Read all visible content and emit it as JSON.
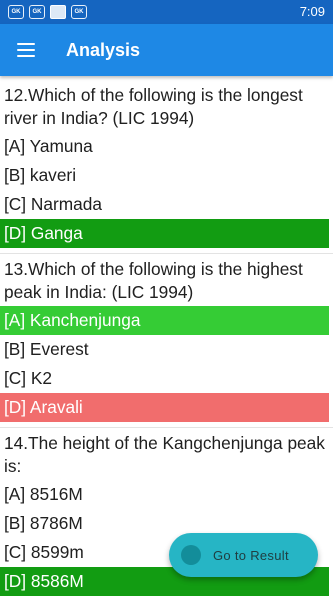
{
  "status_bar": {
    "time": "7:09",
    "notification_icons": [
      {
        "name": "gk-app-icon",
        "text": "GK"
      },
      {
        "name": "gk-app-icon",
        "text": "GK"
      },
      {
        "name": "image-icon",
        "text": ""
      },
      {
        "name": "gk-app-icon",
        "text": "GK"
      }
    ]
  },
  "app_bar": {
    "title": "Analysis",
    "menu_icon": "hamburger-menu-icon"
  },
  "questions": [
    {
      "text": "12.Which of the following is the longest river in India? (LIC 1994)",
      "options": [
        {
          "label": "[A] Yamuna",
          "state": "none"
        },
        {
          "label": "[B] kaveri",
          "state": "none"
        },
        {
          "label": "[C] Narmada",
          "state": "none"
        },
        {
          "label": "[D] Ganga",
          "state": "correct-dark"
        }
      ]
    },
    {
      "text": "13.Which of the following is the highest peak in India: (LIC 1994)",
      "options": [
        {
          "label": "[A] Kanchenjunga",
          "state": "correct-light"
        },
        {
          "label": "[B] Everest",
          "state": "none"
        },
        {
          "label": "[C] K2",
          "state": "none"
        },
        {
          "label": "[D] Aravali",
          "state": "wrong"
        }
      ]
    },
    {
      "text": "14.The height of the Kangchenjunga peak is:",
      "options": [
        {
          "label": "[A] 8516M",
          "state": "none"
        },
        {
          "label": "[B] 8786M",
          "state": "none"
        },
        {
          "label": "[C] 8599m",
          "state": "none"
        },
        {
          "label": "[D] 8586M",
          "state": "correct-dark"
        }
      ]
    }
  ],
  "fab": {
    "label": "Go to Result"
  },
  "colors": {
    "status_bar": "#1565c0",
    "app_bar": "#1e88e5",
    "correct_dark": "#129c12",
    "correct_light": "#35cc35",
    "wrong": "#f16d6d",
    "fab": "#26b5c5"
  }
}
